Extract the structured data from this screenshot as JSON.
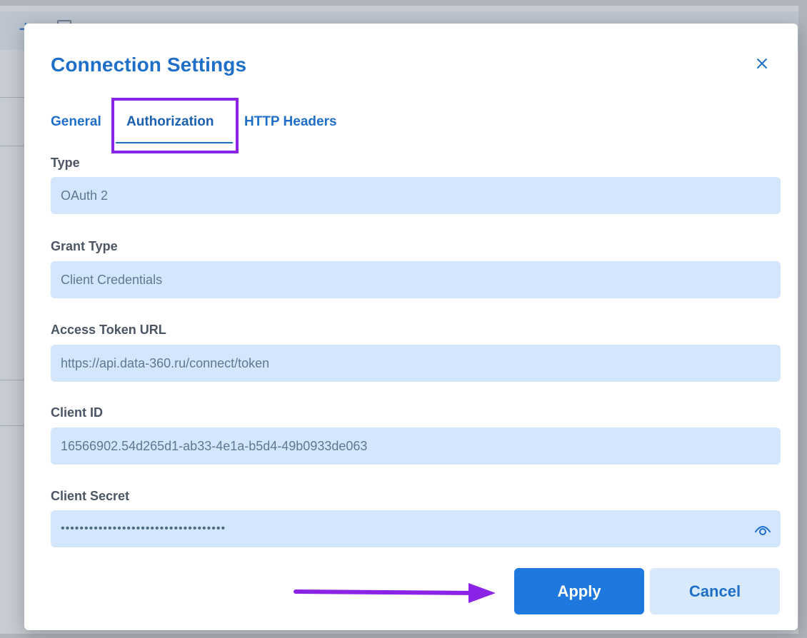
{
  "dialog": {
    "title": "Connection Settings",
    "close_icon": "close-icon"
  },
  "tabs": [
    {
      "label": "General",
      "active": false
    },
    {
      "label": "Authorization",
      "active": true
    },
    {
      "label": "HTTP Headers",
      "active": false
    }
  ],
  "fields": {
    "type": {
      "label": "Type",
      "value": "OAuth 2"
    },
    "grant_type": {
      "label": "Grant Type",
      "value": "Client Credentials"
    },
    "access_token_url": {
      "label": "Access Token URL",
      "value": "https://api.data-360.ru/connect/token"
    },
    "client_id": {
      "label": "Client ID",
      "value": "16566902.54d265d1-ab33-4e1a-b5d4-49b0933de063"
    },
    "client_secret": {
      "label": "Client Secret",
      "value": "•••••••••••••••••••••••••••••••••••",
      "icon": "eye-icon"
    }
  },
  "buttons": {
    "apply": "Apply",
    "cancel": "Cancel"
  },
  "annotations": {
    "highlight_color": "#8a23e6",
    "arrow_icon": "arrow-right-icon"
  },
  "colors": {
    "accent": "#1f78dd",
    "input_bg": "#d3e6fb",
    "title": "#1f6fc8"
  }
}
